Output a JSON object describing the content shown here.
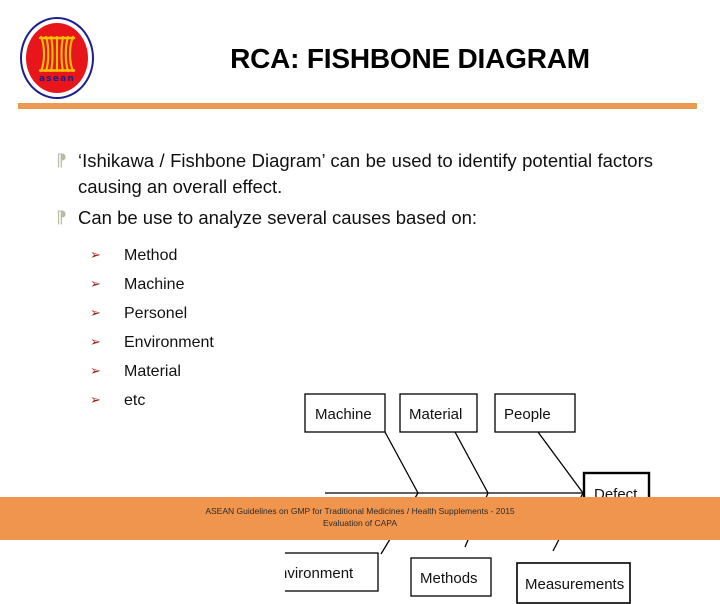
{
  "header": {
    "title": "RCA: FISHBONE DIAGRAM",
    "logo": {
      "word": "asean",
      "ring_color": "#1c1f8c",
      "disc_color": "#e8161b",
      "sheaf_color": "#f5c200"
    },
    "rule_color": "#ec9a52"
  },
  "content": {
    "bullet_mark": "⁋",
    "bullets": [
      {
        "text": "‘Ishikawa / Fishbone Diagram’ can be used to identify potential factors causing an overall effect."
      },
      {
        "text": "Can be use to analyze several causes based on:"
      }
    ],
    "sub_bullet_mark": "➢",
    "sub_bullets": [
      {
        "label": "Method"
      },
      {
        "label": "Machine"
      },
      {
        "label": "Personel"
      },
      {
        "label": "Environment"
      },
      {
        "label": "Material"
      },
      {
        "label": "etc"
      }
    ]
  },
  "figure": {
    "type": "fishbone-diagram",
    "effect": "Defect",
    "causes_top": [
      "Machine",
      "Material",
      "People"
    ],
    "causes_bottom": [
      "Environment",
      "Methods",
      "Measurements"
    ]
  },
  "footer": {
    "line1": "ASEAN Guidelines on GMP for Traditional Medicines  / Health Supplements  -  2015",
    "line2": "Evaluation of CAPA",
    "background": "#f0954e"
  }
}
